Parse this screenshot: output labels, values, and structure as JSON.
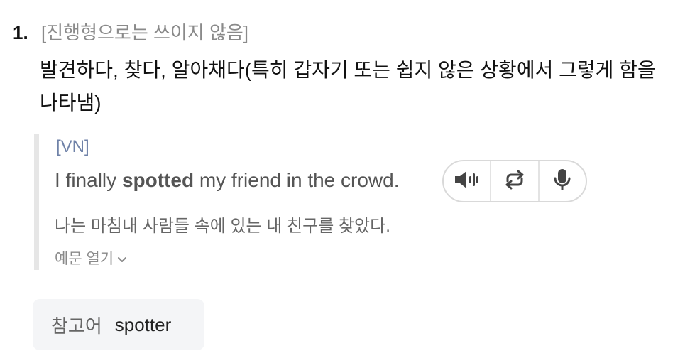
{
  "sense": {
    "number": "1.",
    "usage_note": "[진행형으로는 쓰이지 않음]",
    "definition": "발견하다, 찾다, 알아채다(특히 갑자기 또는 쉽지 않은 상황에서 그렇게 함을 나타냄)"
  },
  "example": {
    "pattern": "[VN]",
    "sentence_before": "I finally ",
    "sentence_bold": "spotted",
    "sentence_after": " my friend in the crowd.",
    "translation": "나는 마침내 사람들 속에 있는 내 친구를 찾았다.",
    "more_label": "예문 열기",
    "controls": {
      "listen_icon": "speaker-icon",
      "repeat_icon": "repeat-icon",
      "record_icon": "microphone-icon"
    }
  },
  "reference": {
    "label": "참고어",
    "word": "spotter"
  },
  "colors": {
    "usage_note": "#8a8a8a",
    "pattern": "#6f82a8",
    "reference_bg": "#f4f5f7",
    "icon": "#444444"
  }
}
